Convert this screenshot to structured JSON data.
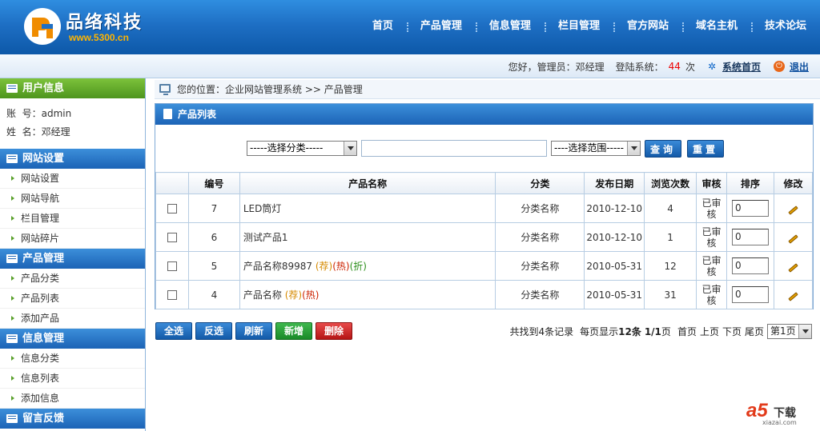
{
  "header": {
    "logo_name": "品络科技",
    "logo_url": "www.5300.cn",
    "nav": [
      "首页",
      "产品管理",
      "信息管理",
      "栏目管理",
      "官方网站",
      "域名主机",
      "技术论坛"
    ]
  },
  "subbar": {
    "greeting": "您好，管理员：邓经理",
    "login_label": "登陆系统：",
    "login_count": "44",
    "login_unit": "次",
    "home_link": "系统首页",
    "exit_link": "退出"
  },
  "sidebar": {
    "user_section": "用户信息",
    "account_label": "账  号：",
    "account_value": "admin",
    "name_label": "姓  名：",
    "name_value": "邓经理",
    "groups": [
      {
        "title": "网站设置",
        "items": [
          "网站设置",
          "网站导航",
          "栏目管理",
          "网站碎片"
        ]
      },
      {
        "title": "产品管理",
        "items": [
          "产品分类",
          "产品列表",
          "添加产品"
        ]
      },
      {
        "title": "信息管理",
        "items": [
          "信息分类",
          "信息列表",
          "添加信息"
        ]
      },
      {
        "title": "留言反馈",
        "items": []
      }
    ]
  },
  "breadcrumb": {
    "label": "您的位置：",
    "path": "企业网站管理系统 >> 产品管理"
  },
  "panel": {
    "title": "产品列表",
    "category_select": "-----选择分类-----",
    "range_select": "----选择范围-----",
    "search_button": "查询",
    "reset_button": "重置"
  },
  "table": {
    "headers": [
      "",
      "编号",
      "产品名称",
      "分类",
      "发布日期",
      "浏览次数",
      "审核",
      "排序",
      "修改"
    ],
    "rows": [
      {
        "id": "7",
        "name": "LED筒灯",
        "rec": "",
        "hot": "",
        "off": "",
        "category": "分类名称",
        "date": "2010-12-10",
        "views": "4",
        "audit_1": "已审",
        "audit_2": "核",
        "sort": "0"
      },
      {
        "id": "6",
        "name": "测试产品1",
        "rec": "",
        "hot": "",
        "off": "",
        "category": "分类名称",
        "date": "2010-12-10",
        "views": "1",
        "audit_1": "已审",
        "audit_2": "核",
        "sort": "0"
      },
      {
        "id": "5",
        "name": "产品名称89987",
        "rec": "(荐)",
        "hot": "(热)",
        "off": "(折)",
        "category": "分类名称",
        "date": "2010-05-31",
        "views": "12",
        "audit_1": "已审",
        "audit_2": "核",
        "sort": "0"
      },
      {
        "id": "4",
        "name": "产品名称",
        "rec": "(荐)",
        "hot": "(热)",
        "off": "",
        "category": "分类名称",
        "date": "2010-05-31",
        "views": "31",
        "audit_1": "已审",
        "audit_2": "核",
        "sort": "0"
      }
    ]
  },
  "toolbar": {
    "select_all": "全选",
    "invert": "反选",
    "refresh": "刷新",
    "add": "新增",
    "delete": "删除"
  },
  "pager": {
    "found": "共找到4条记录",
    "per_page": "每页显示",
    "per_page_num": "12条",
    "page_of": "1/1",
    "page_unit": "页",
    "first": "首页",
    "prev": "上页",
    "next": "下页",
    "last": "尾页",
    "page_select": "第1页"
  },
  "watermark": {
    "brand": "a5",
    "label": "下载",
    "url": "xiazai.com"
  },
  "colors": {
    "header_blue": "#1e6fc4",
    "user_green": "#5aa12c",
    "alert_red": "#e00000"
  }
}
